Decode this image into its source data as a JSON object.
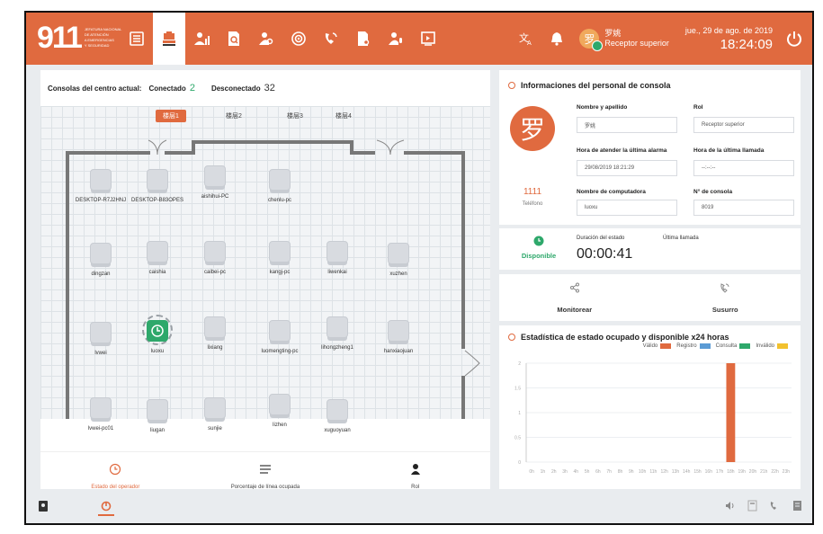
{
  "topbar": {
    "logo_number": "911",
    "logo_lines": [
      "JEFATURA NACIONAL",
      "DE ATENCIÓN",
      "A EMERGENCIAS",
      "Y SEGURIDAD"
    ],
    "nav_icons": [
      "list-icon",
      "stamp-icon",
      "user-stats-icon",
      "search-doc-icon",
      "user-search-icon",
      "target-icon",
      "phone-icon",
      "doc-search-icon",
      "user-mic-icon",
      "screen-icon"
    ],
    "active_nav": 1,
    "user_initial": "罗",
    "user_name": "罗姚",
    "user_role": "Receptor superior",
    "date": "jue., 29 de ago. de 2019",
    "time": "18:24:09"
  },
  "left": {
    "consoles_label": "Consolas del centro actual:",
    "connected_label": "Conectado",
    "connected_count": "2",
    "disconnected_label": "Desconectado",
    "disconnected_count": "32",
    "floor_tabs": [
      "楼层1",
      "楼层2",
      "楼层3",
      "楼层4"
    ],
    "active_tab": 0,
    "workstations": [
      {
        "name": "DESKTOP-R7J2HNJ",
        "active": false
      },
      {
        "name": "DESKTOP-B83OPES",
        "active": false
      },
      {
        "name": "aishihui-PC",
        "active": false
      },
      {
        "name": "chenlu-pc",
        "active": false
      },
      {
        "name": "dingzan",
        "active": false
      },
      {
        "name": "caishia",
        "active": false
      },
      {
        "name": "caibei-pc",
        "active": false
      },
      {
        "name": "kangj-pc",
        "active": false
      },
      {
        "name": "liwenkai",
        "active": false
      },
      {
        "name": "xuzhen",
        "active": false
      },
      {
        "name": "lvwei",
        "active": false
      },
      {
        "name": "luoxu",
        "active": true
      },
      {
        "name": "lixiang",
        "active": false
      },
      {
        "name": "luomengting-pc",
        "active": false
      },
      {
        "name": "lihongzheng1",
        "active": false
      },
      {
        "name": "hanxiaojuan",
        "active": false
      },
      {
        "name": "lvwei-pc01",
        "active": false
      },
      {
        "name": "liugan",
        "active": false
      },
      {
        "name": "sunjie",
        "active": false
      },
      {
        "name": "lizhen",
        "active": false
      },
      {
        "name": "xuguoyuan",
        "active": false
      }
    ],
    "bottom_tabs": [
      "Estado del operador",
      "Porcentaje de línea ocupada",
      "Rol"
    ],
    "active_bottom": 0
  },
  "right": {
    "info_title": "Informaciones del personal de consola",
    "avatar": "罗",
    "phone_number": "1111",
    "phone_label": "Teléfono",
    "name_label": "Nombre y apellido",
    "name_value": "罗姚",
    "role_label": "Rol",
    "role_value": "Receptor superior",
    "last_alarm_label": "Hora de atender la última alarma",
    "last_alarm_value": "29/08/2019 18:21:29",
    "last_call_label": "Hora de la última llamada",
    "last_call_value": "--:--:--",
    "computer_label": "Nombre de computadora",
    "computer_value": "luoxu",
    "console_label": "N° de consola",
    "console_value": "8019",
    "status_label": "Disponible",
    "duration_label": "Duración del estado",
    "duration_value": "00:00:41",
    "last_call_title": "Última llamada",
    "monitor_label": "Monitorear",
    "whisper_label": "Susurro"
  },
  "chart_data": {
    "type": "bar",
    "title": "Estadística de estado ocupado y disponible x24 horas",
    "legend": [
      "Válido",
      "Registro",
      "Consulta",
      "Inválido"
    ],
    "legend_colors": [
      "#e06a3f",
      "#5b9bd5",
      "#2ea86b",
      "#f2c12e"
    ],
    "categories": [
      "0h",
      "1h",
      "2h",
      "3h",
      "4h",
      "5h",
      "6h",
      "7h",
      "8h",
      "9h",
      "10h",
      "11h",
      "12h",
      "13h",
      "14h",
      "15h",
      "16h",
      "17h",
      "18h",
      "19h",
      "20h",
      "21h",
      "22h",
      "23h"
    ],
    "series": [
      {
        "name": "Válido",
        "values": [
          0,
          0,
          0,
          0,
          0,
          0,
          0,
          0,
          0,
          0,
          0,
          0,
          0,
          0,
          0,
          0,
          0,
          0,
          2,
          0,
          0,
          0,
          0,
          0
        ]
      },
      {
        "name": "Registro",
        "values": [
          0,
          0,
          0,
          0,
          0,
          0,
          0,
          0,
          0,
          0,
          0,
          0,
          0,
          0,
          0,
          0,
          0,
          0,
          0,
          0,
          0,
          0,
          0,
          0
        ]
      },
      {
        "name": "Consulta",
        "values": [
          0,
          0,
          0,
          0,
          0,
          0,
          0,
          0,
          0,
          0,
          0,
          0,
          0,
          0,
          0,
          0,
          0,
          0,
          0,
          0,
          0,
          0,
          0,
          0
        ]
      },
      {
        "name": "Inválido",
        "values": [
          0,
          0,
          0,
          0,
          0,
          0,
          0,
          0,
          0,
          0,
          0,
          0,
          0,
          0,
          0,
          0,
          0,
          0,
          0,
          0,
          0,
          0,
          0,
          0
        ]
      }
    ],
    "yticks": [
      "0",
      "0.5",
      "1",
      "1.5",
      "2"
    ],
    "ylim": [
      0,
      2
    ],
    "grid": true,
    "legend_position": "top-right"
  }
}
